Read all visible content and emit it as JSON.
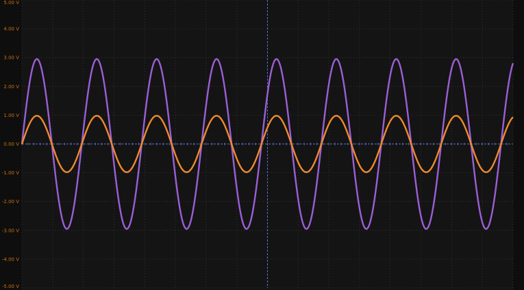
{
  "colors": {
    "background": "#0e0e0e",
    "plot_area": "#141414",
    "grid": "#3a3a3a",
    "center_axis": "#5a6fd0",
    "axis_label": "#c9720f",
    "channel_a": "#9b5fd6",
    "channel_b": "#ef8a2e"
  },
  "chart_data": {
    "type": "line",
    "title": "",
    "xlabel": "",
    "ylabel": "",
    "y_tick_labels": [
      "5.00 V",
      "4.00 V",
      "3.00 V",
      "2.00 V",
      "1.00 V",
      "0.00 V",
      "-1.00 V",
      "-2.00 V",
      "-3.00 V",
      "-4.00 V",
      "-5.00 V"
    ],
    "ylim": [
      -5,
      5
    ],
    "grid": true,
    "x_divisions": 16,
    "y_divisions": 10,
    "cycles_on_screen": 8.2,
    "series": [
      {
        "amplitude_v": 2.95,
        "offset_v": 0.0,
        "color": "#9b5fd6"
      },
      {
        "amplitude_v": 0.98,
        "offset_v": 0.0,
        "color": "#ef8a2e"
      }
    ]
  }
}
